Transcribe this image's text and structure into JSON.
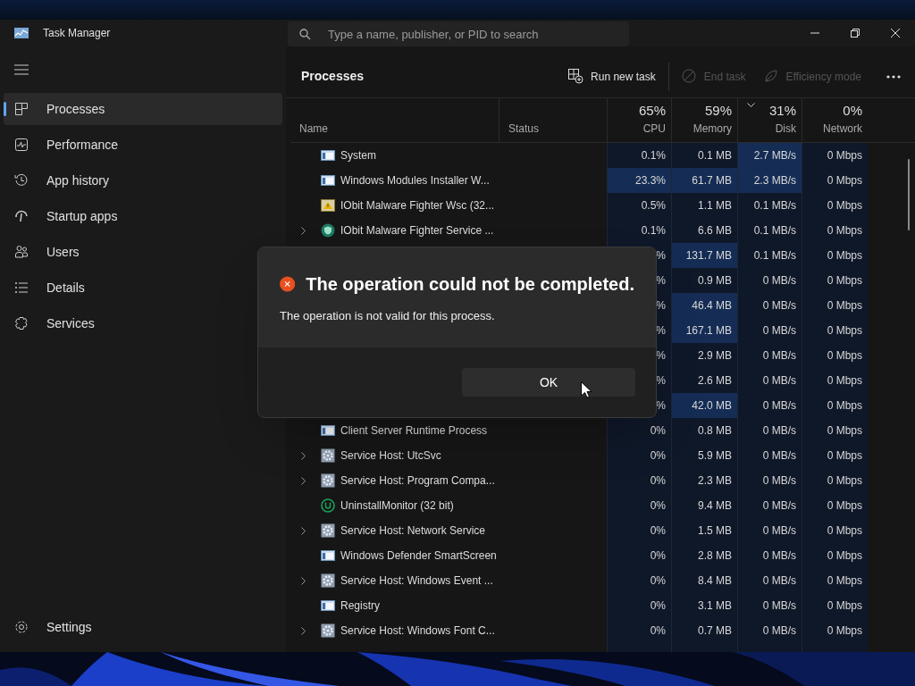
{
  "window": {
    "title": "Task Manager"
  },
  "search": {
    "placeholder": "Type a name, publisher, or PID to search"
  },
  "sidebar": {
    "items": [
      {
        "label": "Processes",
        "selected": true
      },
      {
        "label": "Performance",
        "selected": false
      },
      {
        "label": "App history",
        "selected": false
      },
      {
        "label": "Startup apps",
        "selected": false
      },
      {
        "label": "Users",
        "selected": false
      },
      {
        "label": "Details",
        "selected": false
      },
      {
        "label": "Services",
        "selected": false
      }
    ],
    "footer": {
      "label": "Settings"
    }
  },
  "page_title": "Processes",
  "toolbar": [
    {
      "label": "Run new task",
      "disabled": false
    },
    {
      "label": "End task",
      "disabled": true
    },
    {
      "label": "Efficiency mode",
      "disabled": true
    }
  ],
  "table": {
    "columns": [
      {
        "label": "Name",
        "sorted": false
      },
      {
        "label": "Status",
        "sorted": false
      },
      {
        "percent": "65%",
        "label": "CPU",
        "sorted": false
      },
      {
        "percent": "59%",
        "label": "Memory",
        "sorted": false
      },
      {
        "percent": "31%",
        "label": "Disk",
        "sorted": true
      },
      {
        "percent": "0%",
        "label": "Network",
        "sorted": false
      }
    ],
    "rows": [
      {
        "name": "System",
        "kind": "app",
        "expandable": false,
        "cpu": {
          "value": "0.1%",
          "hot": false
        },
        "memory": {
          "value": "0.1 MB",
          "hot": false
        },
        "disk": {
          "value": "2.7 MB/s",
          "hot": true
        },
        "network": {
          "value": "0 Mbps",
          "hot": false
        }
      },
      {
        "name": "Windows Modules Installer W...",
        "kind": "app",
        "expandable": false,
        "cpu": {
          "value": "23.3%",
          "hot": true
        },
        "memory": {
          "value": "61.7 MB",
          "hot": true
        },
        "disk": {
          "value": "2.3 MB/s",
          "hot": true
        },
        "network": {
          "value": "0 Mbps",
          "hot": false
        }
      },
      {
        "name": "IObit Malware Fighter Wsc (32...",
        "kind": "warning",
        "expandable": false,
        "cpu": {
          "value": "0.5%",
          "hot": false
        },
        "memory": {
          "value": "1.1 MB",
          "hot": false
        },
        "disk": {
          "value": "0.1 MB/s",
          "hot": false
        },
        "network": {
          "value": "0 Mbps",
          "hot": false
        }
      },
      {
        "name": "IObit Malware Fighter Service ...",
        "kind": "shield",
        "expandable": true,
        "cpu": {
          "value": "0.1%",
          "hot": false
        },
        "memory": {
          "value": "6.6 MB",
          "hot": false
        },
        "disk": {
          "value": "0.1 MB/s",
          "hot": false
        },
        "network": {
          "value": "0 Mbps",
          "hot": false
        }
      },
      {
        "cpu": {
          "value": "%",
          "hot": false
        },
        "memory": {
          "value": "131.7 MB",
          "hot": true
        },
        "disk": {
          "value": "0.1 MB/s",
          "hot": false
        },
        "network": {
          "value": "0 Mbps",
          "hot": false
        }
      },
      {
        "cpu": {
          "value": "%",
          "hot": false
        },
        "memory": {
          "value": "0.9 MB",
          "hot": false
        },
        "disk": {
          "value": "0 MB/s",
          "hot": false
        },
        "network": {
          "value": "0 Mbps",
          "hot": false
        }
      },
      {
        "cpu": {
          "value": "%",
          "hot": false
        },
        "memory": {
          "value": "46.4 MB",
          "hot": true
        },
        "disk": {
          "value": "0 MB/s",
          "hot": false
        },
        "network": {
          "value": "0 Mbps",
          "hot": false
        }
      },
      {
        "cpu": {
          "value": "%",
          "hot": false
        },
        "memory": {
          "value": "167.1 MB",
          "hot": true
        },
        "disk": {
          "value": "0 MB/s",
          "hot": false
        },
        "network": {
          "value": "0 Mbps",
          "hot": false
        }
      },
      {
        "cpu": {
          "value": "%",
          "hot": false
        },
        "memory": {
          "value": "2.9 MB",
          "hot": false
        },
        "disk": {
          "value": "0 MB/s",
          "hot": false
        },
        "network": {
          "value": "0 Mbps",
          "hot": false
        }
      },
      {
        "cpu": {
          "value": "%",
          "hot": false
        },
        "memory": {
          "value": "2.6 MB",
          "hot": false
        },
        "disk": {
          "value": "0 MB/s",
          "hot": false
        },
        "network": {
          "value": "0 Mbps",
          "hot": false
        }
      },
      {
        "cpu": {
          "value": "%",
          "hot": false
        },
        "memory": {
          "value": "42.0 MB",
          "hot": true
        },
        "disk": {
          "value": "0 MB/s",
          "hot": false
        },
        "network": {
          "value": "0 Mbps",
          "hot": false
        }
      },
      {
        "name": "Client Server Runtime Process",
        "kind": "app",
        "expandable": false,
        "cpu": {
          "value": "0%",
          "hot": false
        },
        "memory": {
          "value": "0.8 MB",
          "hot": false
        },
        "disk": {
          "value": "0 MB/s",
          "hot": false
        },
        "network": {
          "value": "0 Mbps",
          "hot": false
        }
      },
      {
        "name": "Service Host: UtcSvc",
        "kind": "service",
        "expandable": true,
        "cpu": {
          "value": "0%",
          "hot": false
        },
        "memory": {
          "value": "5.9 MB",
          "hot": false
        },
        "disk": {
          "value": "0 MB/s",
          "hot": false
        },
        "network": {
          "value": "0 Mbps",
          "hot": false
        }
      },
      {
        "name": "Service Host: Program Compa...",
        "kind": "service",
        "expandable": true,
        "cpu": {
          "value": "0%",
          "hot": false
        },
        "memory": {
          "value": "2.3 MB",
          "hot": false
        },
        "disk": {
          "value": "0 MB/s",
          "hot": false
        },
        "network": {
          "value": "0 Mbps",
          "hot": false
        }
      },
      {
        "name": "UninstallMonitor (32 bit)",
        "kind": "uninstall",
        "expandable": false,
        "cpu": {
          "value": "0%",
          "hot": false
        },
        "memory": {
          "value": "9.4 MB",
          "hot": false
        },
        "disk": {
          "value": "0 MB/s",
          "hot": false
        },
        "network": {
          "value": "0 Mbps",
          "hot": false
        }
      },
      {
        "name": "Service Host: Network Service",
        "kind": "service",
        "expandable": true,
        "cpu": {
          "value": "0%",
          "hot": false
        },
        "memory": {
          "value": "1.5 MB",
          "hot": false
        },
        "disk": {
          "value": "0 MB/s",
          "hot": false
        },
        "network": {
          "value": "0 Mbps",
          "hot": false
        }
      },
      {
        "name": "Windows Defender SmartScreen",
        "kind": "app",
        "expandable": false,
        "cpu": {
          "value": "0%",
          "hot": false
        },
        "memory": {
          "value": "2.8 MB",
          "hot": false
        },
        "disk": {
          "value": "0 MB/s",
          "hot": false
        },
        "network": {
          "value": "0 Mbps",
          "hot": false
        }
      },
      {
        "name": "Service Host: Windows Event ...",
        "kind": "service",
        "expandable": true,
        "cpu": {
          "value": "0%",
          "hot": false
        },
        "memory": {
          "value": "8.4 MB",
          "hot": false
        },
        "disk": {
          "value": "0 MB/s",
          "hot": false
        },
        "network": {
          "value": "0 Mbps",
          "hot": false
        }
      },
      {
        "name": "Registry",
        "kind": "app",
        "expandable": false,
        "cpu": {
          "value": "0%",
          "hot": false
        },
        "memory": {
          "value": "3.1 MB",
          "hot": false
        },
        "disk": {
          "value": "0 MB/s",
          "hot": false
        },
        "network": {
          "value": "0 Mbps",
          "hot": false
        }
      },
      {
        "name": "Service Host: Windows Font C...",
        "kind": "service",
        "expandable": true,
        "cpu": {
          "value": "0%",
          "hot": false
        },
        "memory": {
          "value": "0.7 MB",
          "hot": false
        },
        "disk": {
          "value": "0 MB/s",
          "hot": false
        },
        "network": {
          "value": "0 Mbps",
          "hot": false
        }
      }
    ]
  },
  "dialog": {
    "title": "The operation could not be completed.",
    "message": "The operation is not valid for this process.",
    "button": "OK"
  }
}
